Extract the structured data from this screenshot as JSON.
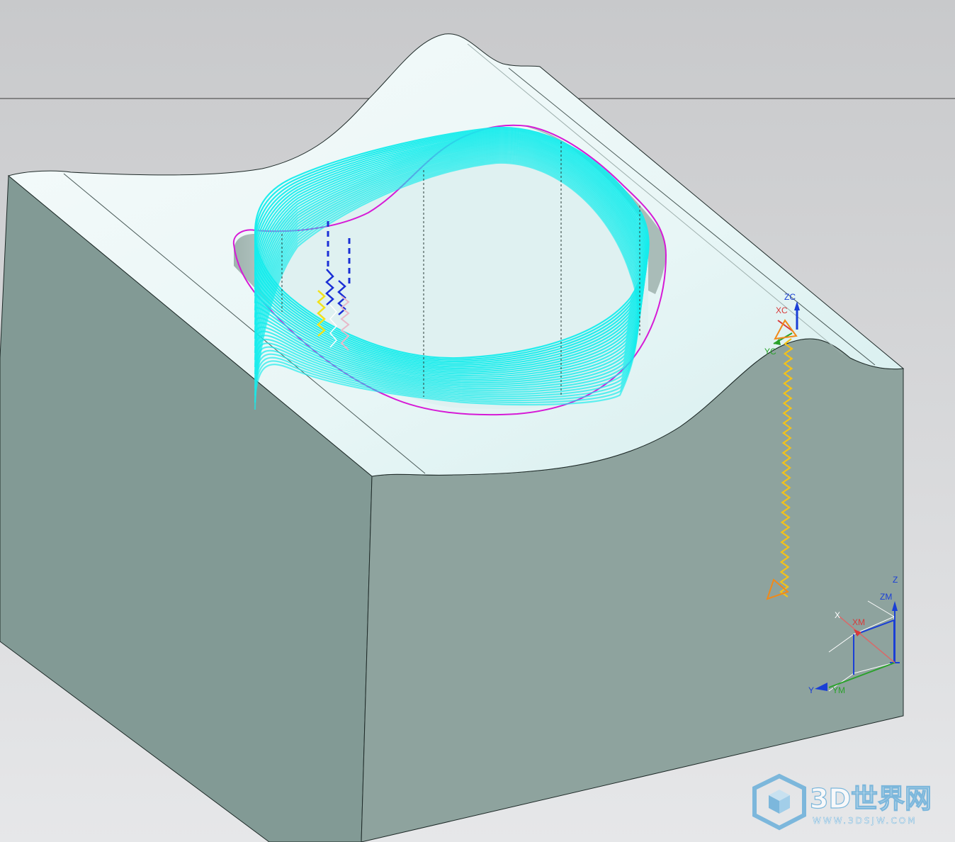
{
  "viewport": {
    "background_top": "#c8c9cb",
    "background_bottom": "#e6e7e9",
    "horizon_line_color": "#3a3a3a"
  },
  "model": {
    "top_surface_color": "#e8f6f6",
    "side_face_left_color": "#829a95",
    "side_face_right_color": "#8ea39e",
    "edge_color": "#1e2a28",
    "boundary_color": "#d61ad6",
    "toolpath_color": "#16ecec",
    "engage_color": "#1a2fd6",
    "approach_color": "#f2c21a"
  },
  "wcs": {
    "zc": "ZC",
    "xc": "XC",
    "yc": "YC",
    "colors": {
      "z": "#1a3fd6",
      "x": "#d83a3a",
      "y": "#2aa22a",
      "tri": "#f08a1a"
    }
  },
  "mcs": {
    "z": "Z",
    "zm": "ZM",
    "x": "X",
    "xm": "XM",
    "y": "Y",
    "ym": "YM"
  },
  "watermark": {
    "name": "3D世界网",
    "url": "WWW.3DSJW.COM",
    "color": "#5aa8d8"
  }
}
